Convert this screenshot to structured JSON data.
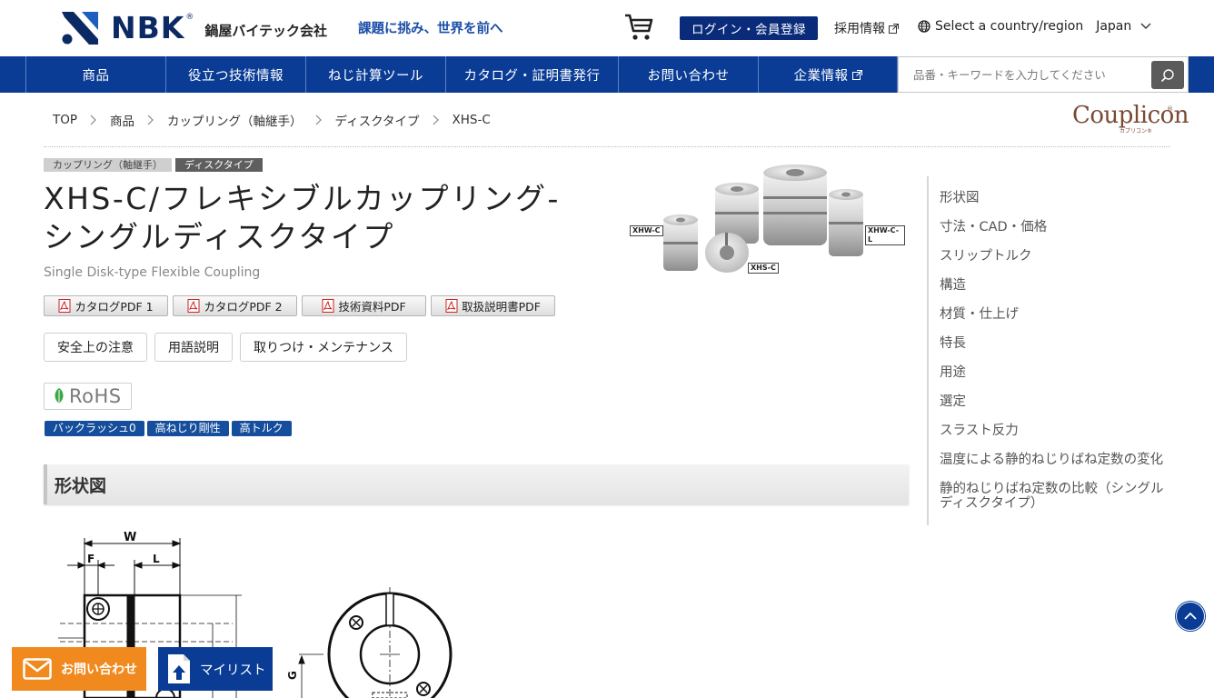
{
  "header": {
    "logo_text": "NBK",
    "logo_reg": "®",
    "company_name": "鍋屋バイテック会社",
    "tagline": "課題に挑み、世界を前へ",
    "login_label": "ログイン・会員登録",
    "recruit_label": "採用情報",
    "country_label": "Select a country/region",
    "country_value": "Japan"
  },
  "nav": {
    "items": [
      {
        "label": "商品"
      },
      {
        "label": "役立つ技術情報"
      },
      {
        "label": "ねじ計算ツール"
      },
      {
        "label": "カタログ・証明書発行"
      },
      {
        "label": "お問い合わせ"
      },
      {
        "label": "企業情報"
      }
    ],
    "search_placeholder": "品番・キーワードを入力してください"
  },
  "breadcrumb": [
    "TOP",
    "商品",
    "カップリング（軸継手）",
    "ディスクタイプ",
    "XHS-C"
  ],
  "brand_badge": {
    "name": "Couplicon",
    "reg": "®",
    "kana": "カプリコン®"
  },
  "product": {
    "category_tags": [
      "カップリング（軸継手）",
      "ディスクタイプ"
    ],
    "title_line1": "XHS-C/フレキシブルカップリング-",
    "title_line2": "シングルディスクタイプ",
    "subtitle": "Single Disk-type Flexible Coupling",
    "pdf_buttons": [
      "カタログPDF 1",
      "カタログPDF 2",
      "技術資料PDF",
      "取扱説明書PDF"
    ],
    "text_buttons": [
      "安全上の注意",
      "用語説明",
      "取りつけ・メンテナンス"
    ],
    "rohs_label": "RoHS",
    "feature_tags": [
      "バックラッシュ0",
      "高ねじり剛性",
      "高トルク"
    ],
    "image_labels": [
      "XHW-C",
      "XHW-C-L",
      "XHS-C"
    ]
  },
  "section": {
    "title": "形状図",
    "drawing_labels": {
      "w": "W",
      "f": "F",
      "l": "L",
      "g": "G"
    }
  },
  "toc": [
    "形状図",
    "寸法・CAD・価格",
    "スリップトルク",
    "構造",
    "材質・仕上げ",
    "特長",
    "用途",
    "選定",
    "スラスト反力",
    "温度による静的ねじりばね定数の変化",
    "静的ねじりばね定数の比較（シングルディスクタイプ）"
  ],
  "floating": {
    "contact_label": "お問い合わせ",
    "mylist_label": "マイリスト"
  },
  "colors": {
    "nav_blue": "#0a3c96",
    "login_navy": "#0a2b7a",
    "tagline_blue": "#1c4fa8",
    "contact_orange": "#f08a1f",
    "brand_brown": "#7a4a33"
  },
  "icons": {
    "cart": "cart-icon",
    "globe": "globe-icon",
    "external": "external-link-icon",
    "search": "search-icon",
    "pdf": "pdf-icon",
    "leaf": "leaf-icon",
    "page_top": "chevron-up-icon",
    "mail": "mail-icon",
    "mylist": "document-upload-icon"
  }
}
